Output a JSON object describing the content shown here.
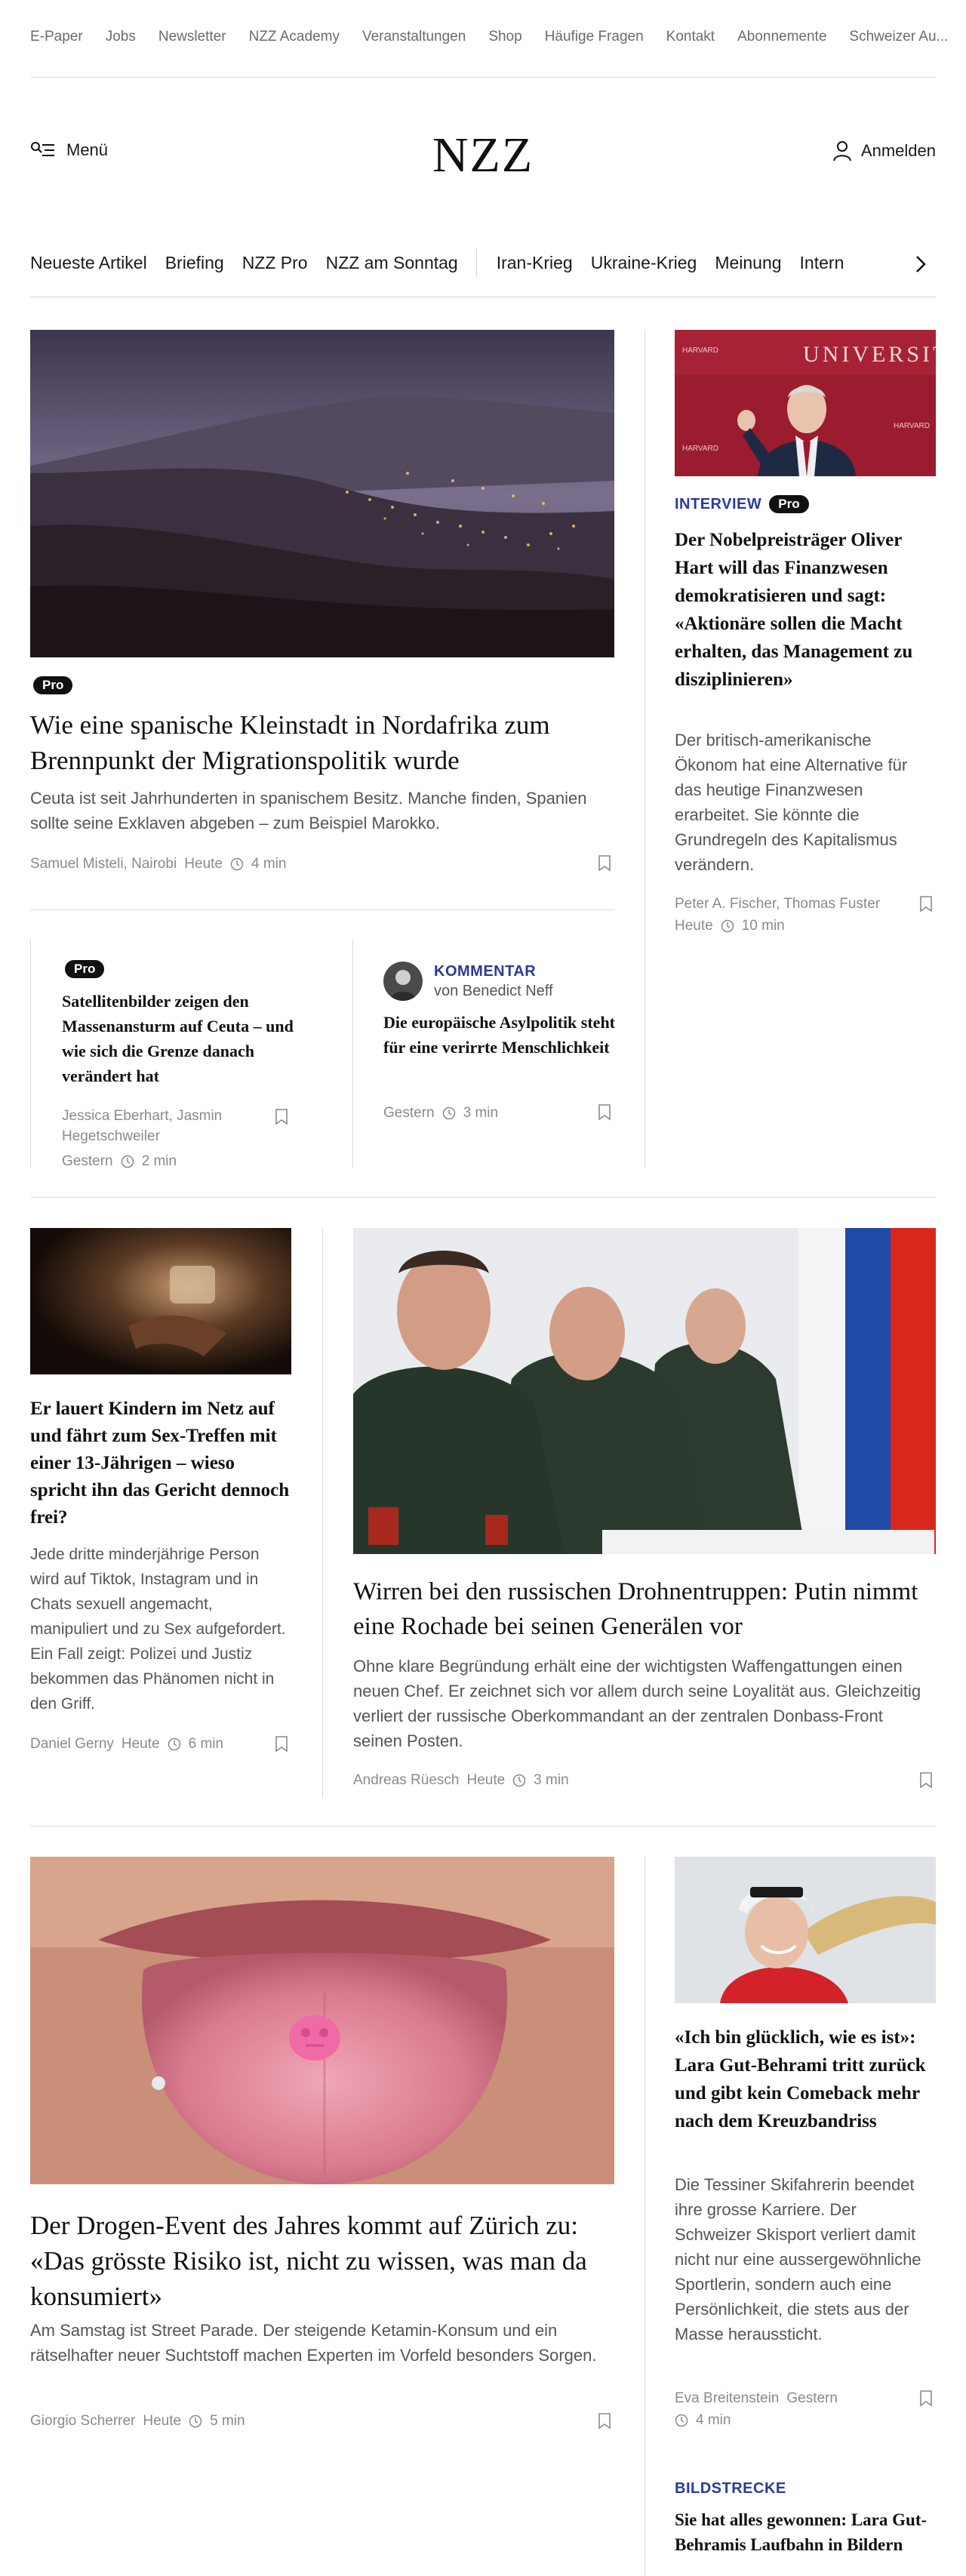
{
  "topbar": [
    "E-Paper",
    "Jobs",
    "Newsletter",
    "NZZ Academy",
    "Veranstaltungen",
    "Shop",
    "Häufige Fragen",
    "Kontakt",
    "Abonnemente",
    "Schweizer Au..."
  ],
  "header": {
    "menu_label": "Menü",
    "logo": "NZZ",
    "login_label": "Anmelden"
  },
  "nav": {
    "group1": [
      "Neueste Artikel",
      "Briefing",
      "NZZ Pro",
      "NZZ am Sonntag"
    ],
    "group2": [
      "Iran-Krieg",
      "Ukraine-Krieg",
      "Meinung",
      "Intern"
    ]
  },
  "pro_label": "Pro",
  "a1": {
    "title": "Wie eine spanische Kleinstadt in Nordafrika zum Brennpunkt der Migrationspolitik wurde",
    "lead": "Ceuta ist seit Jahrhunderten in spanischem Besitz. Manche finden, Spanien sollte seine Exklaven abgeben – zum Beispiel Marokko.",
    "authors": "Samuel Misteli, Nairobi",
    "date": "Heute",
    "readtime": "4 min"
  },
  "a2": {
    "kicker": "INTERVIEW",
    "title": "Der Nobelpreisträger Oliver Hart will das Finanzwesen demokratisieren und sagt: «Aktionäre sollen die Macht erhalten, das Management zu disziplinieren»",
    "lead": "Der britisch-amerikanische Ökonom hat eine Alternative für das heutige Finanzwesen erarbeitet. Sie könnte die Grundregeln des Kapitalismus verändern.",
    "authors": "Peter A. Fischer, Thomas Fuster",
    "date": "Heute",
    "readtime": "10 min",
    "image_text": "UNIVERSITY"
  },
  "a3": {
    "title": "Satellitenbilder zeigen den Massenansturm auf Ceuta – und wie sich die Grenze danach verändert hat",
    "authors": "Jessica Eberhart, Jasmin Hegetschweiler",
    "date": "Gestern",
    "readtime": "2 min"
  },
  "a4": {
    "kicker": "KOMMENTAR",
    "byline": "von Benedict Neff",
    "title": "Die europäische Asylpolitik steht für eine verirrte Menschlichkeit",
    "date": "Gestern",
    "readtime": "3 min"
  },
  "a5": {
    "title": "Er lauert Kindern im Netz auf und fährt zum Sex-Treffen mit einer 13-Jährigen – wieso spricht ihn das Gericht dennoch frei?",
    "lead": "Jede dritte minderjährige Person wird auf Tiktok, Instagram und in Chats sexuell angemacht, manipuliert und zu Sex aufgefordert. Ein Fall zeigt: Polizei und Justiz bekommen das Phänomen nicht in den Griff.",
    "authors": "Daniel Gerny",
    "date": "Heute",
    "readtime": "6 min"
  },
  "a6": {
    "title": "Wirren bei den russischen Drohnentruppen: Putin nimmt eine Rochade bei seinen Generälen vor",
    "lead": "Ohne klare Begründung erhält eine der wichtigsten Waffengattungen einen neuen Chef. Er zeichnet sich vor allem durch seine Loyalität aus. Gleichzeitig verliert der russische Oberkommandant an der zentralen Donbass-Front seinen Posten.",
    "authors": "Andreas Rüesch",
    "date": "Heute",
    "readtime": "3 min"
  },
  "a7": {
    "title": "Der Drogen-Event des Jahres kommt auf Zürich zu: «Das grösste Risiko ist, nicht zu wissen, was man da konsumiert»",
    "lead": "Am Samstag ist Street Parade. Der steigende Ketamin-Konsum und ein rätselhafter neuer Suchtstoff machen Experten im Vorfeld besonders Sorgen.",
    "authors": "Giorgio Scherrer",
    "date": "Heute",
    "readtime": "5 min"
  },
  "a8": {
    "title": "«Ich bin glücklich, wie es ist»: Lara Gut-Behrami tritt zurück und gibt kein Comeback mehr nach dem Kreuzbandriss",
    "lead": "Die Tessiner Skifahrerin beendet ihre grosse Karriere. Der Schweizer Skisport verliert damit nicht nur eine aussergewöhnliche Sportlerin, sondern auch eine Persönlichkeit, die stets aus der Masse heraussticht.",
    "authors": "Eva Breitenstein",
    "date": "Gestern",
    "readtime": "4 min"
  },
  "a9": {
    "kicker": "BILDSTRECKE",
    "title": "Sie hat alles gewonnen: Lara Gut-Behramis Laufbahn in Bildern"
  },
  "colors": {
    "kicker": "#2b3a9a",
    "text": "#1a1a1a",
    "meta": "#8a8a8a",
    "rule": "#d9d9d9"
  }
}
